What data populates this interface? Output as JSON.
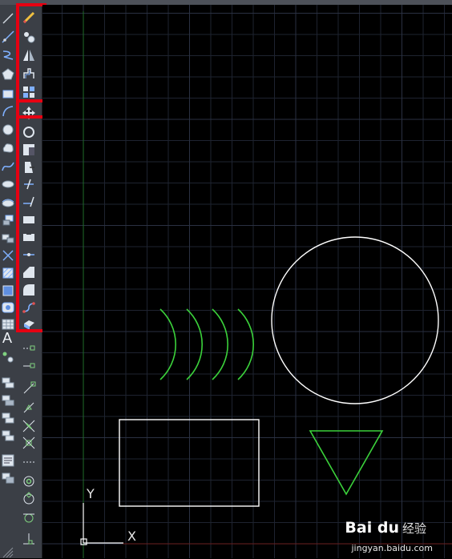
{
  "app": {
    "title": ""
  },
  "toolbars": {
    "draw": {
      "name": "draw-toolbar",
      "tools": [
        {
          "name": "line-tool",
          "icon": "line-icon"
        },
        {
          "name": "construction-line-tool",
          "icon": "construction-line-icon"
        },
        {
          "name": "polyline-tool",
          "icon": "polyline-icon"
        },
        {
          "name": "polygon-tool",
          "icon": "polygon-icon"
        },
        {
          "name": "rectangle-tool",
          "icon": "rectangle-icon"
        },
        {
          "name": "arc-tool",
          "icon": "arc-icon"
        },
        {
          "name": "circle-tool",
          "icon": "circle-icon"
        },
        {
          "name": "revcloud-tool",
          "icon": "revcloud-icon"
        },
        {
          "name": "spline-tool",
          "icon": "spline-icon"
        },
        {
          "name": "ellipse-tool",
          "icon": "ellipse-icon"
        },
        {
          "name": "ellipse-arc-tool",
          "icon": "ellipse-arc-icon"
        },
        {
          "name": "insert-block-tool",
          "icon": "insert-block-icon"
        },
        {
          "name": "make-block-tool",
          "icon": "make-block-icon"
        },
        {
          "name": "point-tool",
          "icon": "point-icon"
        },
        {
          "name": "hatch-tool",
          "icon": "hatch-icon"
        },
        {
          "name": "gradient-tool",
          "icon": "gradient-icon"
        },
        {
          "name": "region-tool",
          "icon": "region-icon"
        },
        {
          "name": "table-tool",
          "icon": "table-icon"
        },
        {
          "name": "multiline-text-tool",
          "icon": "text-icon",
          "label": "A"
        },
        {
          "name": "add-selected-tool",
          "icon": "add-selected-icon"
        },
        {
          "name": "block-editor-tool",
          "icon": "block-editor-icon"
        },
        {
          "name": "write-block-tool",
          "icon": "write-block-icon"
        },
        {
          "name": "attribute-tool",
          "icon": "attribute-icon"
        },
        {
          "name": "copy-block-tool",
          "icon": "copy-block-icon"
        },
        {
          "name": "text-style-tool",
          "icon": "text-style-icon"
        },
        {
          "name": "external-ref-tool",
          "icon": "external-ref-icon"
        }
      ]
    },
    "modify": {
      "name": "modify-toolbar",
      "tools": [
        {
          "name": "erase-tool",
          "icon": "erase-pencil-icon"
        },
        {
          "name": "copy-tool",
          "icon": "copy-icon"
        },
        {
          "name": "mirror-tool",
          "icon": "mirror-icon"
        },
        {
          "name": "offset-tool",
          "icon": "offset-icon"
        },
        {
          "name": "array-tool",
          "icon": "array-icon"
        },
        {
          "name": "move-tool",
          "icon": "move-icon"
        },
        {
          "name": "rotate-tool",
          "icon": "rotate-icon"
        },
        {
          "name": "scale-tool",
          "icon": "scale-icon"
        },
        {
          "name": "stretch-tool",
          "icon": "stretch-icon"
        },
        {
          "name": "trim-tool",
          "icon": "trim-icon"
        },
        {
          "name": "extend-tool",
          "icon": "extend-icon"
        },
        {
          "name": "break-at-point-tool",
          "icon": "break-at-point-icon"
        },
        {
          "name": "break-tool",
          "icon": "break-icon"
        },
        {
          "name": "join-tool",
          "icon": "join-icon"
        },
        {
          "name": "chamfer-tool",
          "icon": "chamfer-icon"
        },
        {
          "name": "fillet-tool",
          "icon": "fillet-icon"
        },
        {
          "name": "blend-curves-tool",
          "icon": "blend-curves-icon"
        },
        {
          "name": "explode-tool",
          "icon": "explode-icon"
        }
      ]
    },
    "snap": {
      "name": "object-snap-toolbar",
      "tools": [
        {
          "name": "snap-temporary-track",
          "icon": "track-icon"
        },
        {
          "name": "snap-from",
          "icon": "snap-from-icon"
        },
        {
          "name": "snap-endpoint",
          "icon": "endpoint-icon"
        },
        {
          "name": "snap-midpoint",
          "icon": "midpoint-icon"
        },
        {
          "name": "snap-intersection",
          "icon": "intersection-icon"
        },
        {
          "name": "snap-apparent-intersection",
          "icon": "apparent-intersection-icon"
        },
        {
          "name": "snap-extension",
          "icon": "extension-icon"
        },
        {
          "name": "snap-center",
          "icon": "center-icon"
        },
        {
          "name": "snap-quadrant",
          "icon": "quadrant-icon"
        },
        {
          "name": "snap-tangent",
          "icon": "tangent-icon"
        }
      ]
    }
  },
  "highlight_color": "#e60012",
  "canvas": {
    "background": "#000000",
    "grid_color": "#1e2330",
    "grid_major_color": "#2a3142",
    "shapes": [
      {
        "name": "arc-series",
        "color": "#3bd13b",
        "count": 4
      },
      {
        "name": "circle",
        "color": "#ffffff"
      },
      {
        "name": "rectangle",
        "color": "#ffffff"
      },
      {
        "name": "triangle",
        "color": "#3bd13b"
      }
    ],
    "ucs": {
      "x_label": "X",
      "y_label": "Y"
    }
  },
  "watermark": {
    "brand": "Bai du",
    "brand_sub": "经验",
    "url": "jingyan.baidu.com"
  }
}
